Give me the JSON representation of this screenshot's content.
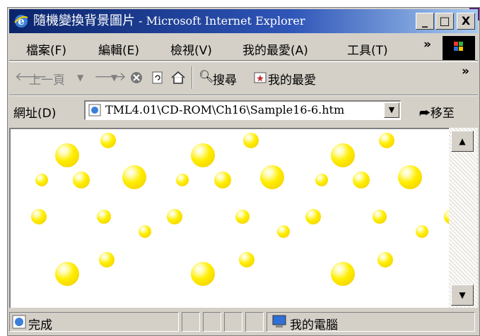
{
  "window": {
    "title": "隨機變換背景圖片",
    "title_suffix": " - Microsoft Internet Explorer",
    "min_label": "_",
    "max_label": "□",
    "close_label": "X"
  },
  "menu": {
    "items": [
      {
        "label": "檔案(F)"
      },
      {
        "label": "編輯(E)"
      },
      {
        "label": "檢視(V)"
      },
      {
        "label": "我的最愛(A)"
      },
      {
        "label": "工具(T)"
      }
    ],
    "more": "»"
  },
  "toolbar": {
    "back": "上一頁",
    "search": "搜尋",
    "favorites": "我的最愛",
    "more": "»"
  },
  "address": {
    "label": "網址(D)",
    "value": "TML4.01\\CD-ROM\\Ch16\\Sample16-6.htm",
    "go": "移至"
  },
  "status": {
    "text": "完成",
    "zone": "我的電腦"
  },
  "icons": {
    "app": "ie-icon",
    "back": "back-arrow-icon",
    "forward": "forward-arrow-icon",
    "stop": "stop-icon",
    "refresh": "refresh-icon",
    "home": "home-icon",
    "search": "search-icon",
    "favorites": "favorites-icon",
    "go": "go-arrow-icon",
    "computer": "computer-icon"
  },
  "colors": {
    "titlebar_start": "#0a246a",
    "titlebar_end": "#a6caf0",
    "chrome": "#d4d0c8",
    "bubble": "#ffee00"
  }
}
